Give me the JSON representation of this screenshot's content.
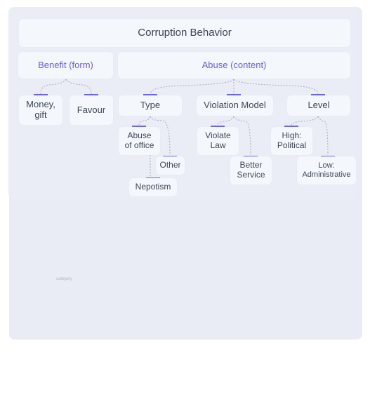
{
  "diagram": {
    "title": "Corruption Behavior",
    "branches": [
      {
        "label": "Benefit (form)",
        "children": [
          {
            "label": "Money,\ngift"
          },
          {
            "label": "Favour"
          }
        ]
      },
      {
        "label": "Abuse (content)",
        "children": [
          {
            "label": "Type",
            "children": [
              {
                "label": "Abuse\nof office",
                "children": [
                  {
                    "label": "Nepotism"
                  }
                ]
              },
              {
                "label": "Other"
              }
            ]
          },
          {
            "label": "Violation Model",
            "children": [
              {
                "label": "Violate\nLaw"
              },
              {
                "label": "Better\nService"
              }
            ]
          },
          {
            "label": "Level",
            "children": [
              {
                "label": "High:\nPolitical"
              },
              {
                "label": "Low:\nAdministrative"
              }
            ]
          }
        ]
      }
    ],
    "faint_label": "category",
    "colors": {
      "accent": "#6c63ee",
      "accent_text": "#6b5ce7",
      "panel": "#e9ecf5",
      "node": "#f4f7fc"
    }
  }
}
